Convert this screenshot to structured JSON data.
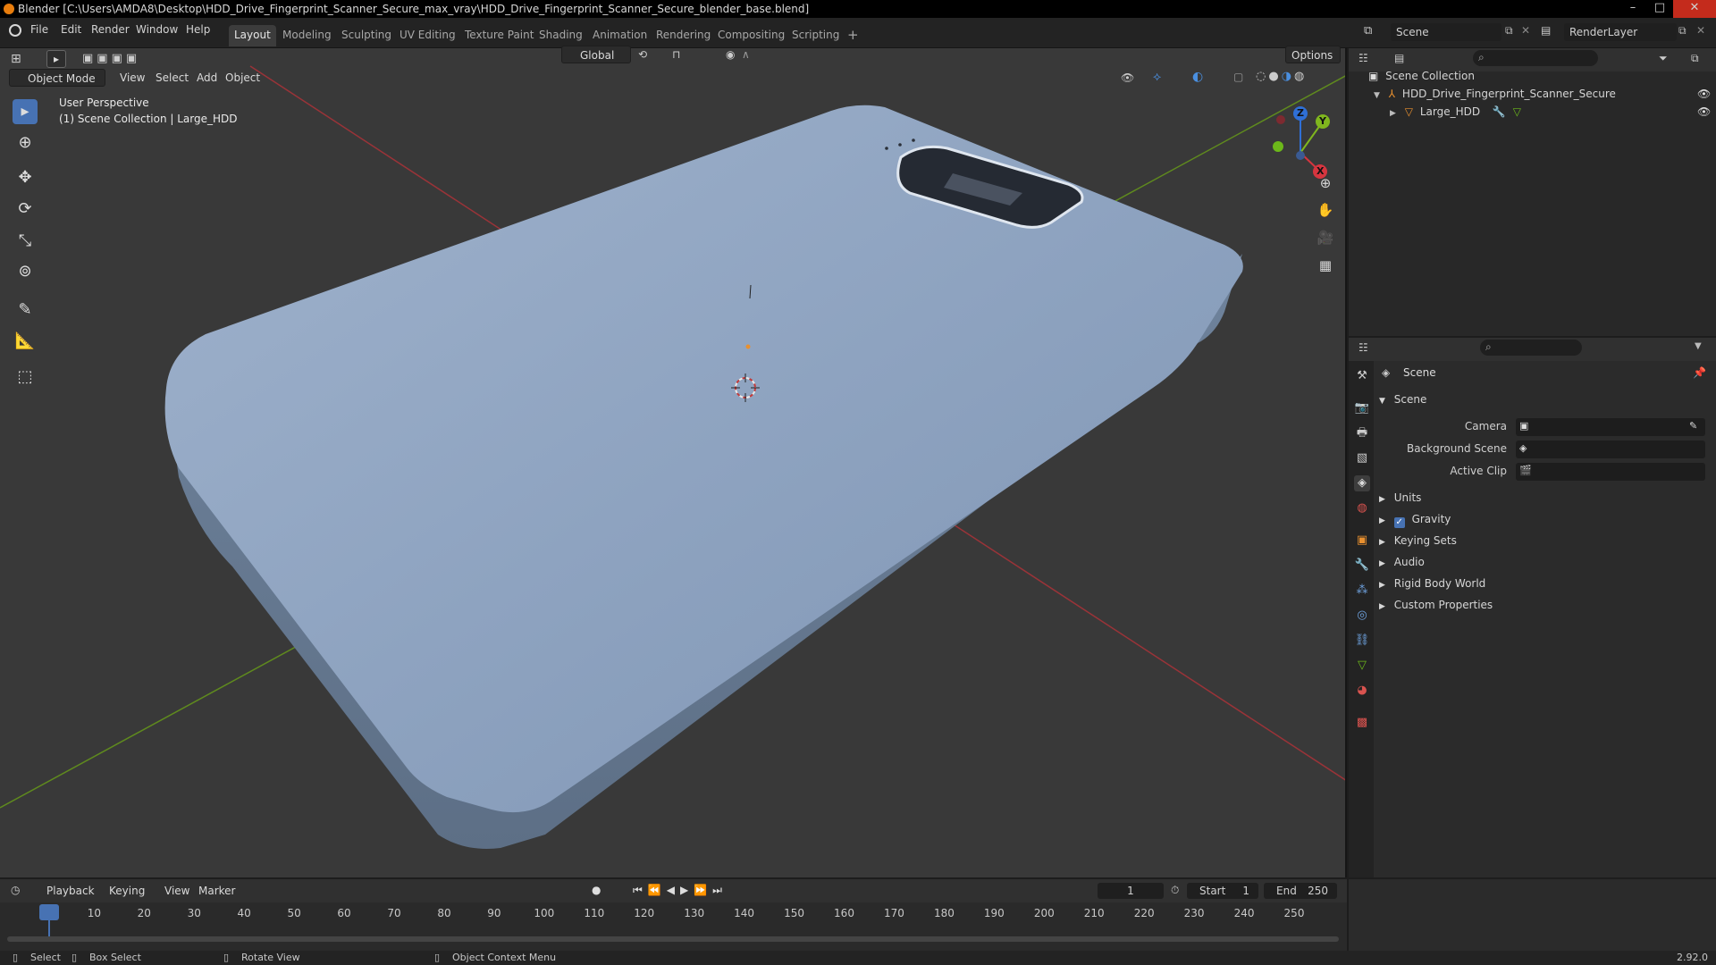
{
  "window": {
    "title": "Blender [C:\\Users\\AMDA8\\Desktop\\HDD_Drive_Fingerprint_Scanner_Secure_max_vray\\HDD_Drive_Fingerprint_Scanner_Secure_blender_base.blend]",
    "controls": [
      "–",
      "□",
      "✕"
    ]
  },
  "menu": [
    "File",
    "Edit",
    "Render",
    "Window",
    "Help"
  ],
  "workspaces": [
    {
      "label": "Layout",
      "active": true
    },
    {
      "label": "Modeling"
    },
    {
      "label": "Sculpting"
    },
    {
      "label": "UV Editing"
    },
    {
      "label": "Texture Paint"
    },
    {
      "label": "Shading"
    },
    {
      "label": "Animation"
    },
    {
      "label": "Rendering"
    },
    {
      "label": "Compositing"
    },
    {
      "label": "Scripting"
    },
    {
      "label": "+"
    }
  ],
  "scene_selector": {
    "value": "Scene"
  },
  "renderlayer_selector": {
    "value": "RenderLayer"
  },
  "viewport": {
    "mode": "Object Mode",
    "menus": [
      "View",
      "Select",
      "Add",
      "Object"
    ],
    "transform_orientation": "Global",
    "options_label": "Options",
    "overlay_text_1": "User Perspective",
    "overlay_text_2": "(1) Scene Collection | Large_HDD",
    "gizmo_axes": {
      "z": "Z",
      "y": "Y",
      "x": "X"
    },
    "colors": {
      "bg": "#393939",
      "object": "#8ea3c0",
      "x_axis": "#c2353d",
      "y_axis": "#6e9a1f",
      "active_tool": "#4772b3"
    }
  },
  "outliner": {
    "root": "Scene Collection",
    "items": [
      {
        "label": "HDD_Drive_Fingerprint_Scanner_Secure"
      },
      {
        "label": "Large_HDD"
      }
    ]
  },
  "properties": {
    "context": "Scene",
    "panel": "Scene",
    "fields": [
      {
        "label": "Camera"
      },
      {
        "label": "Background Scene"
      },
      {
        "label": "Active Clip"
      }
    ],
    "subpanels": [
      {
        "label": "Units"
      },
      {
        "label": "Gravity",
        "checkbox": true
      },
      {
        "label": "Keying Sets"
      },
      {
        "label": "Audio"
      },
      {
        "label": "Rigid Body World"
      },
      {
        "label": "Custom Properties"
      }
    ]
  },
  "timeline": {
    "menus": [
      "Playback",
      "Keying",
      "View",
      "Marker"
    ],
    "current_frame": "1",
    "start_label": "Start",
    "start_value": "1",
    "end_label": "End",
    "end_value": "250",
    "ticks": [
      "1",
      "10",
      "20",
      "30",
      "40",
      "50",
      "60",
      "70",
      "80",
      "90",
      "100",
      "110",
      "120",
      "130",
      "140",
      "150",
      "160",
      "170",
      "180",
      "190",
      "200",
      "210",
      "220",
      "230",
      "240",
      "250"
    ]
  },
  "statusbar": {
    "items": [
      "Select",
      "Box Select",
      "Rotate View",
      "Object Context Menu"
    ],
    "version": "2.92.0"
  }
}
